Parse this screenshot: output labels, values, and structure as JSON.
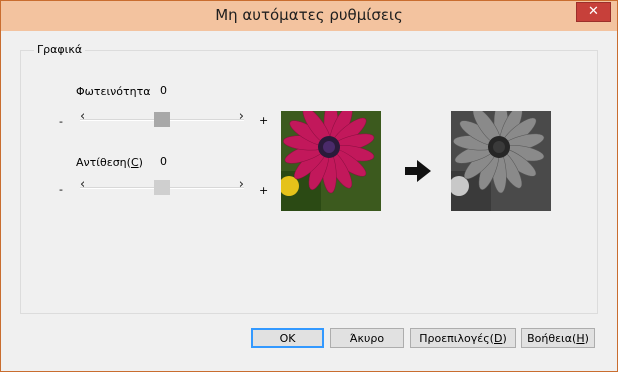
{
  "window": {
    "title": "Μη αυτόματες ρυθμίσεις",
    "close_glyph": "✕"
  },
  "group": {
    "label": "Γραφικά"
  },
  "brightness": {
    "label": "Φωτεινότητα",
    "value": "0",
    "minus": "-",
    "plus": "+",
    "left": "‹",
    "right": "›",
    "level": 0.5
  },
  "contrast": {
    "label_prefix": "Αντίθεση(",
    "label_key": "C",
    "label_suffix": ")",
    "value": "0",
    "minus": "-",
    "plus": "+",
    "left": "‹",
    "right": "›",
    "level": 0.5
  },
  "preview": {
    "arrow_icon": "arrow-right-icon"
  },
  "buttons": {
    "ok": "OK",
    "cancel": "Άκυρο",
    "defaults_prefix": "Προεπιλογές(",
    "defaults_key": "D",
    "defaults_suffix": ")",
    "help_prefix": "Βοήθεια(",
    "help_key": "H",
    "help_suffix": ")"
  },
  "colors": {
    "accent": "#3399ff",
    "titlebar": "#f3c39f",
    "close": "#c7403a"
  }
}
